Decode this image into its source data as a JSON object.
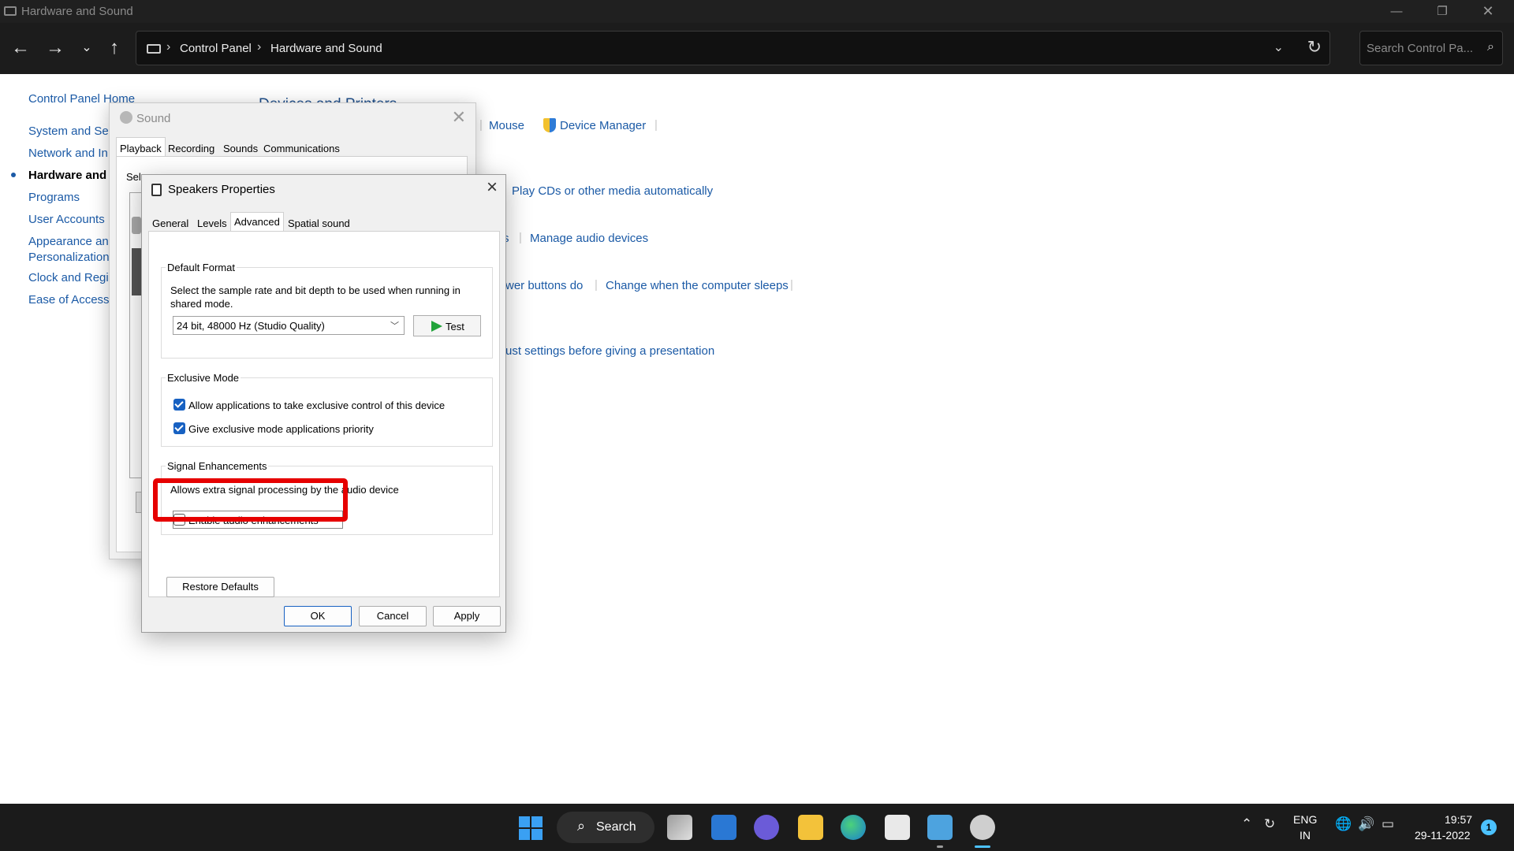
{
  "window": {
    "title": "Hardware and Sound"
  },
  "address": {
    "crumbs": [
      "Control Panel",
      "Hardware and Sound"
    ],
    "search_placeholder": "Search Control Pa..."
  },
  "left_nav": {
    "home": "Control Panel Home",
    "items": [
      "System and Sec",
      "Network and In",
      "Hardware and",
      "Programs",
      "User Accounts",
      "Appearance an",
      "Personalization",
      "Clock and Regio",
      "Ease of Access"
    ]
  },
  "main": {
    "header_partial": "Devices and Printers",
    "links": [
      "Mouse",
      "Device Manager",
      "Play CDs or other media automatically",
      "s",
      "Manage audio devices",
      "wer buttons do",
      "Change when the computer sleeps",
      "ust settings before giving a presentation"
    ]
  },
  "sound_dialog": {
    "title": "Sound",
    "tabs": [
      "Playback",
      "Recording",
      "Sounds",
      "Communications"
    ],
    "desc_partial": "Sel"
  },
  "props_dialog": {
    "title": "Speakers Properties",
    "tabs": [
      "General",
      "Levels",
      "Advanced",
      "Spatial sound"
    ],
    "default_format": {
      "label": "Default Format",
      "desc": "Select the sample rate and bit depth to be used when running in shared mode.",
      "value": "24 bit, 48000 Hz (Studio Quality)",
      "test_label": "Test"
    },
    "exclusive_mode": {
      "label": "Exclusive Mode",
      "opt1": "Allow applications to take exclusive control of this device",
      "opt2": "Give exclusive mode applications priority"
    },
    "signal": {
      "label": "Signal Enhancements",
      "desc": "Allows extra signal processing by the audio device",
      "opt": "Enable audio enhancements"
    },
    "restore_label": "Restore Defaults",
    "ok_label": "OK",
    "cancel_label": "Cancel",
    "apply_label": "Apply"
  },
  "taskbar": {
    "search_label": "Search",
    "lang": "ENG",
    "region": "IN",
    "time": "19:57",
    "date": "29-11-2022",
    "notifications": "1"
  }
}
